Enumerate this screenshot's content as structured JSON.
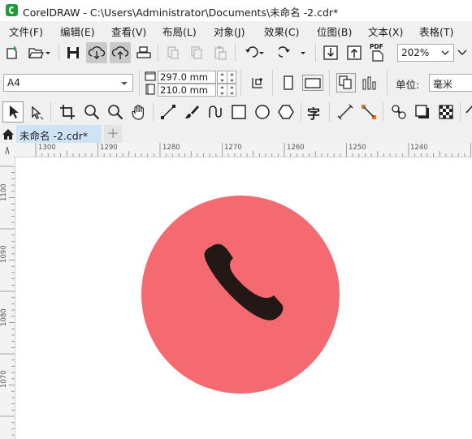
{
  "window": {
    "title": "CorelDRAW - C:\\Users\\Administrator\\Documents\\未命名 -2.cdr*"
  },
  "menu": [
    "文件(F)",
    "编辑(E)",
    "查看(V)",
    "布局(L)",
    "对象(J)",
    "效果(C)",
    "位图(B)",
    "文本(X)",
    "表格(T)"
  ],
  "toolbar": {
    "zoom_value": "202%",
    "pdf_label": "PDF"
  },
  "property_bar": {
    "page_size": "A4",
    "width": "297.0 mm",
    "height": "210.0 mm",
    "units_label": "单位:",
    "units_value": "毫米"
  },
  "toolbox": {
    "text_tool_glyph": "字"
  },
  "tabs": {
    "document": "未命名 -2.cdr*",
    "add": "+"
  },
  "rulers": {
    "horizontal_labels": [
      "1300",
      "1290",
      "1280",
      "1270",
      "1260",
      "1250",
      "1240"
    ],
    "vertical_labels": [
      "1100",
      "1090",
      "1080",
      "1070"
    ]
  },
  "canvas": {
    "circle_color": "#f56a70",
    "handset_color": "#231815",
    "icon": "phone-handset-icon"
  }
}
